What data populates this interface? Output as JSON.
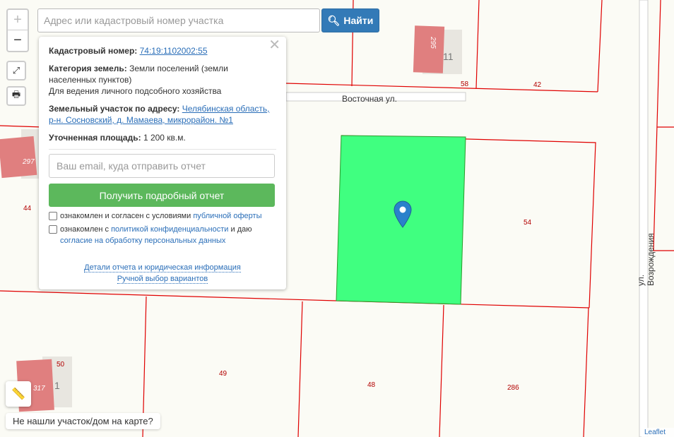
{
  "search": {
    "placeholder": "Адрес или кадастровый номер участка",
    "button": "Найти"
  },
  "zoom": {
    "in": "+",
    "out": "−"
  },
  "map": {
    "roads": [
      "Восточная ул.",
      "ул. Возрождения"
    ],
    "parcel_labels": [
      "58",
      "42",
      "44",
      "54",
      "49",
      "48",
      "286",
      "50"
    ],
    "building_labels": [
      "295",
      "11",
      "297",
      "317",
      "1"
    ],
    "selected_color": "#40ff80",
    "parcel_border": "#e00000"
  },
  "popup": {
    "cadastral_label": "Кадастровый номер:",
    "cadastral_value": "74:19:1102002:55",
    "category_label": "Категория земель:",
    "category_value": "Земли поселений (земли населенных пунктов)",
    "usage": "Для ведения личного подсобного хозяйства",
    "address_label": "Земельный участок по адресу:",
    "address_value": "Челябинская область, р-н. Сосновский, д. Мамаева, микрорайон. №1",
    "area_label": "Уточненная площадь:",
    "area_value": "1 200 кв.м.",
    "email_placeholder": "Ваш email, куда отправить отчет",
    "report_button": "Получить подробный отчет",
    "check1_text": "ознакомлен и согласен с условиями ",
    "check1_link": "публичной оферты",
    "check2_text": "ознакомлен с ",
    "check2_link": "политикой конфиденциальности",
    "check2_mid": " и даю ",
    "check2_link2": "согласие на обработку персональных данных",
    "details_link": "Детали отчета и юридическая информация",
    "manual_link": "Ручной выбор вариантов"
  },
  "not_found": "Не нашли участок/дом на карте?",
  "attribution": "Leaflet"
}
